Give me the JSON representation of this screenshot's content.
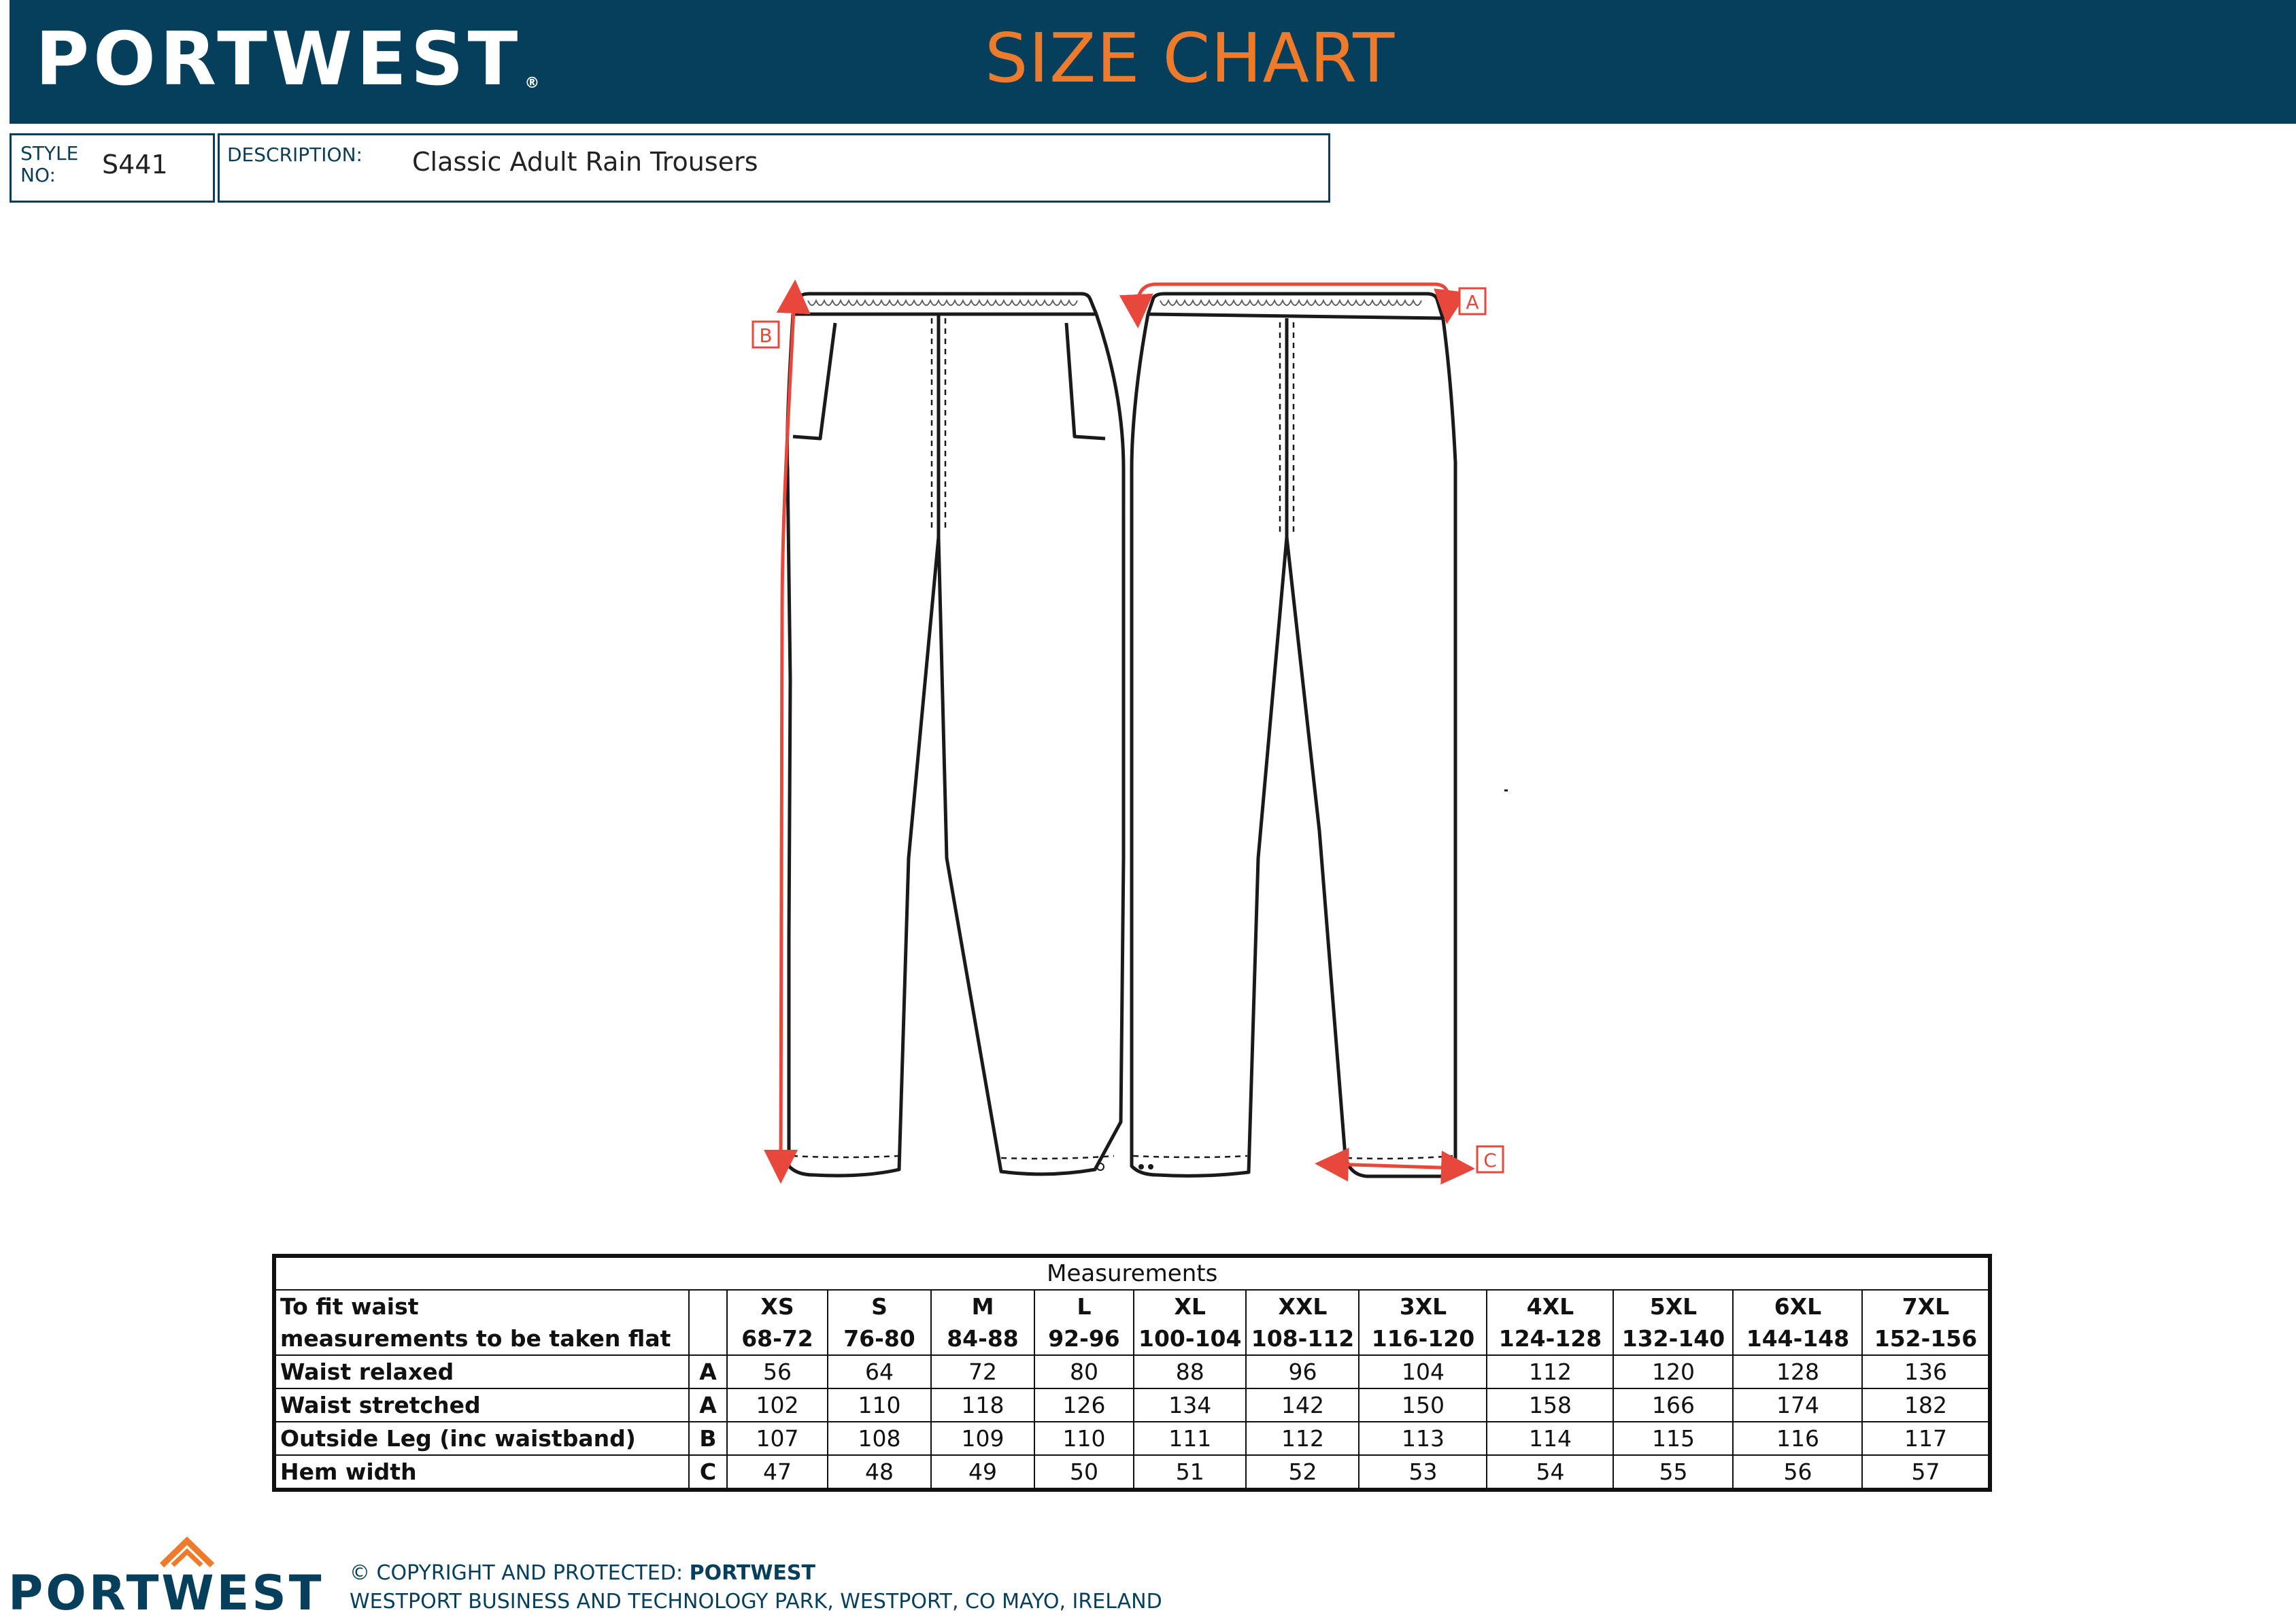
{
  "header": {
    "brand": "PORTWEST",
    "registered": "®",
    "title": "SIZE CHART"
  },
  "info": {
    "style_label": "STYLE NO:",
    "style_value": "S441",
    "description_label": "DESCRIPTION:",
    "description_value": "Classic Adult Rain Trousers"
  },
  "diagram": {
    "marker_a": "A",
    "marker_b": "B",
    "marker_c": "C"
  },
  "table": {
    "caption": "Measurements",
    "fit_label": "To fit waist",
    "flat_label": "measurements to be taken flat",
    "sizes": [
      "XS",
      "S",
      "M",
      "L",
      "XL",
      "XXL",
      "3XL",
      "4XL",
      "5XL",
      "6XL",
      "7XL"
    ],
    "waist_ranges": [
      "68-72",
      "76-80",
      "84-88",
      "92-96",
      "100-104",
      "108-112",
      "116-120",
      "124-128",
      "132-140",
      "144-148",
      "152-156"
    ],
    "rows": [
      {
        "label": "Waist relaxed",
        "code": "A",
        "values": [
          "56",
          "64",
          "72",
          "80",
          "88",
          "96",
          "104",
          "112",
          "120",
          "128",
          "136"
        ]
      },
      {
        "label": "Waist stretched",
        "code": "A",
        "values": [
          "102",
          "110",
          "118",
          "126",
          "134",
          "142",
          "150",
          "158",
          "166",
          "174",
          "182"
        ]
      },
      {
        "label": "Outside Leg (inc waistband)",
        "code": "B",
        "values": [
          "107",
          "108",
          "109",
          "110",
          "111",
          "112",
          "113",
          "114",
          "115",
          "116",
          "117"
        ]
      },
      {
        "label": "Hem width",
        "code": "C",
        "values": [
          "47",
          "48",
          "49",
          "50",
          "51",
          "52",
          "53",
          "54",
          "55",
          "56",
          "57"
        ]
      }
    ]
  },
  "footer": {
    "brand": "PORTWEST",
    "copyright_prefix": "© COPYRIGHT AND PROTECTED: ",
    "copyright_owner": "PORTWEST",
    "address": "WESTPORT BUSINESS AND TECHNOLOGY PARK, WESTPORT, CO MAYO, IRELAND"
  },
  "colors": {
    "navy": "#053f5b",
    "orange": "#ee7b2b",
    "red": "#e8473b"
  }
}
